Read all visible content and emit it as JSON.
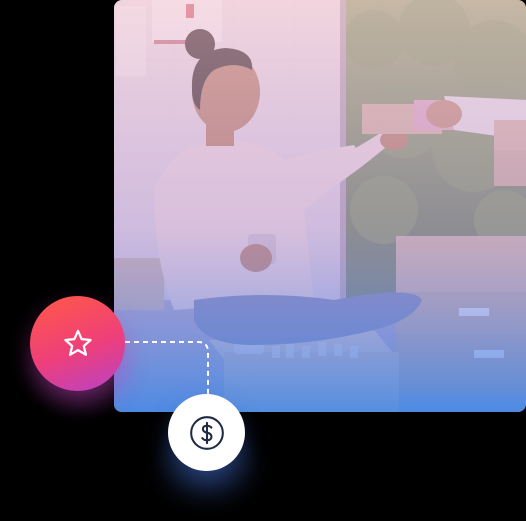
{
  "icons": {
    "star": "star-icon",
    "dollar": "dollar-icon"
  },
  "colors": {
    "background": "#000000",
    "badge_gradient_start": "#ff5a45",
    "badge_gradient_mid": "#ef3f7a",
    "badge_gradient_end": "#b642c8",
    "dollar_badge": "#ffffff",
    "photo_overlay_top": "#f2b7c9",
    "photo_overlay_bottom": "#3f7fe3"
  }
}
